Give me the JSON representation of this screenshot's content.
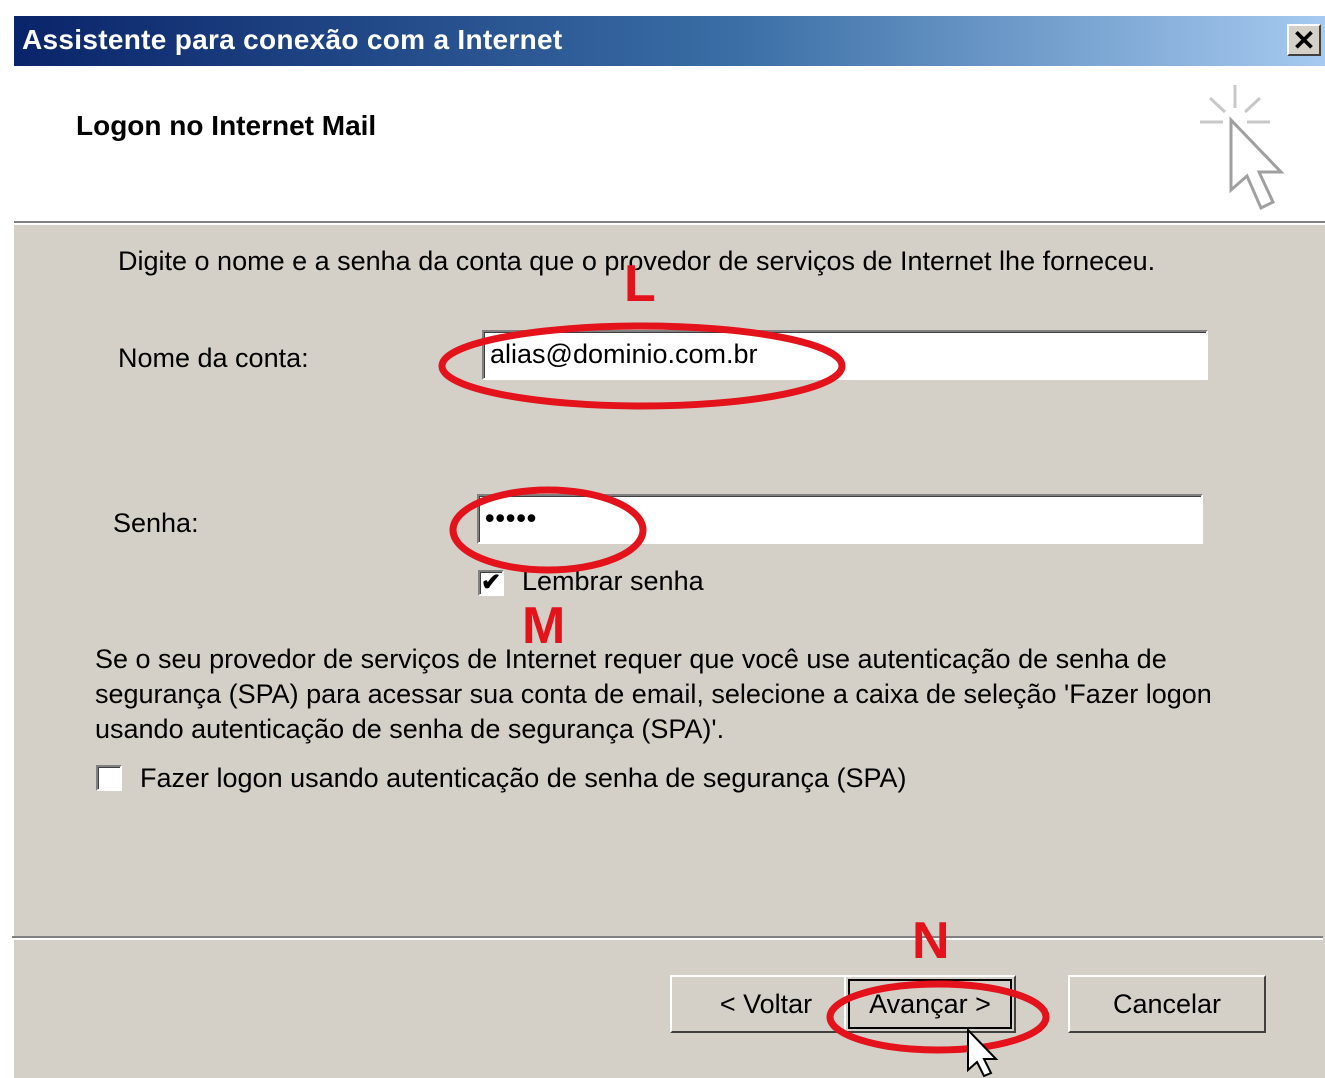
{
  "window": {
    "title": "Assistente para conexão com a Internet",
    "close_label": "✕"
  },
  "header": {
    "title": "Logon no Internet Mail",
    "icon": "wizard-cursor-icon"
  },
  "form": {
    "intro": "Digite o nome e a senha da conta que o provedor de serviços de Internet lhe forneceu.",
    "account_label": "Nome da conta:",
    "account_value": "alias@dominio.com.br",
    "password_label": "Senha:",
    "password_value": "•••••",
    "remember_label": "Lembrar senha",
    "remember_checked": true,
    "remember_check_glyph": "✔",
    "spa_paragraph": "Se o seu provedor de serviços de Internet requer que você use autenticação de senha de segurança (SPA) para acessar sua conta de email, selecione a caixa de seleção 'Fazer logon usando autenticação de senha de segurança (SPA)'.",
    "spa_label": "Fazer logon usando autenticação de senha de segurança (SPA)",
    "spa_checked": false
  },
  "buttons": {
    "back": "< Voltar",
    "next": "Avançar >",
    "cancel": "Cancelar"
  },
  "annotations": {
    "letters": [
      "L",
      "M",
      "N"
    ],
    "color": "#e3121b"
  },
  "colors": {
    "titlebar_start": "#0a246a",
    "titlebar_end": "#a6caf0",
    "dialog_face": "#d4d0c8"
  }
}
